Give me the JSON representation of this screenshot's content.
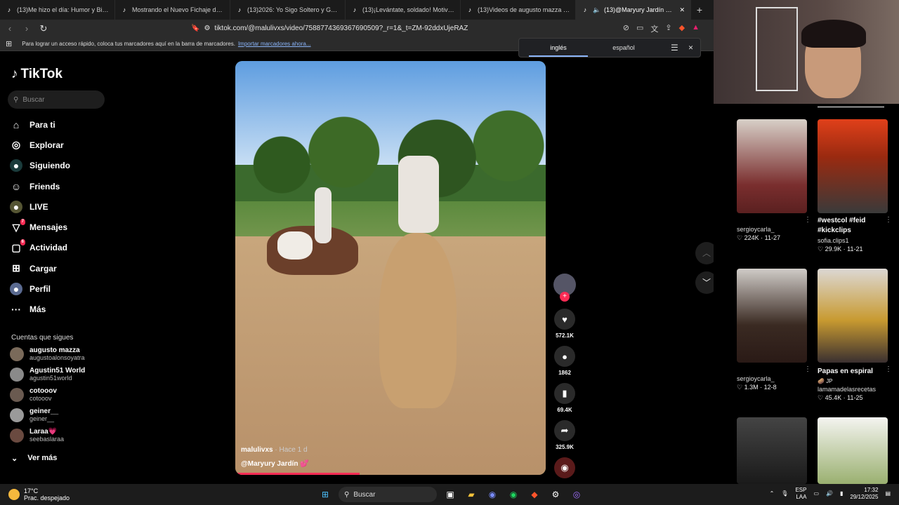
{
  "browser": {
    "tabs": [
      "(13)Me hizo el día: Humor y Bicicleta",
      "Mostrando el Nuevo Fichaje de West",
      "(13)2026: Yo Sigo Soltero y Gozando",
      "(13)¡Levántate, soldado! Motivación",
      "(13)Videos de augusto mazza (@aug",
      "(13)@Maryury Jardín 💕 | Tik"
    ],
    "url": "tiktok.com/@malulivxs/video/7588774369367690509?_r=1&_t=ZM-92ddxUjeRAZ",
    "bookmarks_text": "Para lograr un acceso rápido, coloca tus marcadores aquí en la barra de marcadores.",
    "bookmarks_link": "Importar marcadores ahora...",
    "translate": {
      "lang1": "inglés",
      "lang2": "español"
    }
  },
  "sidebar": {
    "logo": "TikTok",
    "search_placeholder": "Buscar",
    "items": [
      {
        "label": "Para ti",
        "icon": "home-icon"
      },
      {
        "label": "Explorar",
        "icon": "compass-icon"
      },
      {
        "label": "Siguiendo",
        "icon": "following-icon"
      },
      {
        "label": "Friends",
        "icon": "friends-icon"
      },
      {
        "label": "LIVE",
        "icon": "live-icon"
      },
      {
        "label": "Mensajes",
        "icon": "messages-icon",
        "badge": "7"
      },
      {
        "label": "Actividad",
        "icon": "activity-icon",
        "badge": "6"
      },
      {
        "label": "Cargar",
        "icon": "upload-icon"
      },
      {
        "label": "Perfil",
        "icon": "profile-icon"
      },
      {
        "label": "Más",
        "icon": "more-icon"
      }
    ],
    "follows_header": "Cuentas que sigues",
    "follows": [
      {
        "name": "augusto mazza",
        "user": "augustoalonsoyatra"
      },
      {
        "name": "Agustin51 World",
        "user": "agustin51world"
      },
      {
        "name": "cotooov",
        "user": "cotooov"
      },
      {
        "name": "geiner__",
        "user": "geiner__"
      },
      {
        "name": "Laraa💗",
        "user": "seebaslaraa"
      }
    ],
    "see_more": "Ver más"
  },
  "video": {
    "author": "malulivxs",
    "time": "· Hace 1 d",
    "tag": "@Maryury Jardín 💕",
    "progress": 0.4
  },
  "actions": {
    "likes": "572.1K",
    "comments": "1862",
    "saves": "69.4K",
    "shares": "325.9K"
  },
  "recs": [
    {
      "user": "sergioycarla_",
      "likes": "224K",
      "date": "11-27",
      "caption": ""
    },
    {
      "user": "sofia.clips1",
      "likes": "29.9K",
      "date": "11-21",
      "caption": "#westcol #feid #kickclips"
    },
    {
      "user": "sergioycarla_",
      "likes": "1.3M",
      "date": "12-8",
      "caption": ""
    },
    {
      "user": "lamamadelasrecetas",
      "likes": "45.4K",
      "date": "11-25",
      "caption": "Papas en espiral",
      "sub": "🥔 JP"
    }
  ],
  "taskbar": {
    "temp": "17°C",
    "weather": "Prac. despejado",
    "search": "Buscar",
    "lang1": "ESP",
    "lang2": "LAA",
    "time": "17:32",
    "date": "29/12/2025"
  }
}
